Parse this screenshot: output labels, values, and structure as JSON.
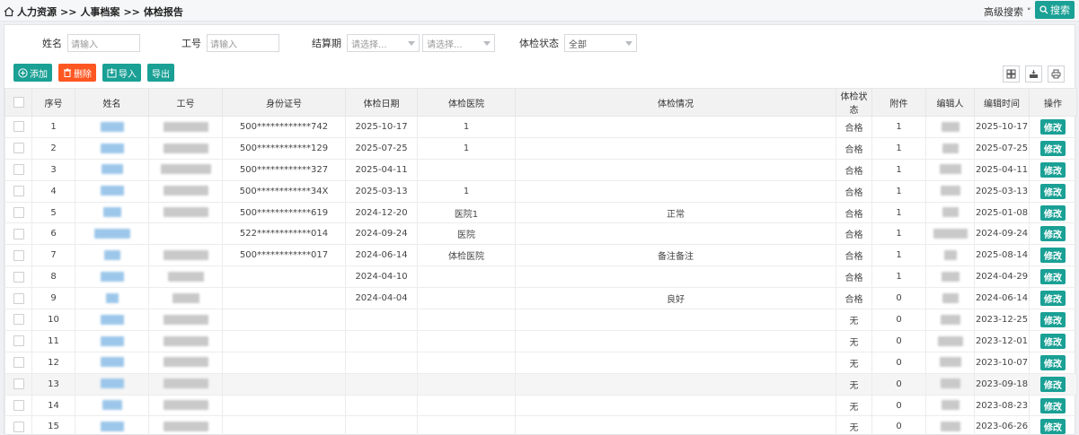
{
  "breadcrumb": {
    "level1": "人力资源",
    "level2": "人事档案",
    "level3": "体检报告",
    "separator": ">>"
  },
  "header": {
    "advanced_search": "高级搜索",
    "search_button": "搜索"
  },
  "filters": {
    "name_label": "姓名",
    "name_placeholder": "请输入",
    "id_label": "工号",
    "id_placeholder": "请输入",
    "period_label": "结算期",
    "period_select1": "请选择...",
    "period_select2": "请选择...",
    "status_label": "体检状态",
    "status_value": "全部"
  },
  "toolbar": {
    "add": "添加",
    "delete": "删除",
    "import": "导入",
    "export": "导出"
  },
  "table": {
    "columns": [
      "序号",
      "姓名",
      "工号",
      "身份证号",
      "体检日期",
      "体检医院",
      "体检情况",
      "体检状态",
      "附件",
      "编辑人",
      "编辑时间",
      "操作"
    ],
    "edit_label": "修改",
    "rows": [
      {
        "no": "1",
        "idcard": "500************742",
        "date": "2025-10-17",
        "hospital": "1",
        "condition": "",
        "status": "合格",
        "attach": "1",
        "edit_time": "2025-10-17"
      },
      {
        "no": "2",
        "idcard": "500************129",
        "date": "2025-07-25",
        "hospital": "1",
        "condition": "",
        "status": "合格",
        "attach": "1",
        "edit_time": "2025-07-25"
      },
      {
        "no": "3",
        "idcard": "500************327",
        "date": "2025-04-11",
        "hospital": "",
        "condition": "",
        "status": "合格",
        "attach": "1",
        "edit_time": "2025-04-11"
      },
      {
        "no": "4",
        "idcard": "500************34X",
        "date": "2025-03-13",
        "hospital": "1",
        "condition": "",
        "status": "合格",
        "attach": "1",
        "edit_time": "2025-03-13"
      },
      {
        "no": "5",
        "idcard": "500************619",
        "date": "2024-12-20",
        "hospital": "医院1",
        "condition": "正常",
        "status": "合格",
        "attach": "1",
        "edit_time": "2025-01-08"
      },
      {
        "no": "6",
        "idcard": "522************014",
        "date": "2024-09-24",
        "hospital": "医院",
        "condition": "",
        "status": "合格",
        "attach": "1",
        "edit_time": "2024-09-24"
      },
      {
        "no": "7",
        "idcard": "500************017",
        "date": "2024-06-14",
        "hospital": "体检医院",
        "condition": "备注备注",
        "status": "合格",
        "attach": "1",
        "edit_time": "2025-08-14"
      },
      {
        "no": "8",
        "idcard": "",
        "date": "2024-04-10",
        "hospital": "",
        "condition": "",
        "status": "合格",
        "attach": "1",
        "edit_time": "2024-04-29"
      },
      {
        "no": "9",
        "idcard": "",
        "date": "2024-04-04",
        "hospital": "",
        "condition": "良好",
        "status": "合格",
        "attach": "0",
        "edit_time": "2024-06-14"
      },
      {
        "no": "10",
        "idcard": "",
        "date": "",
        "hospital": "",
        "condition": "",
        "status": "无",
        "attach": "0",
        "edit_time": "2023-12-25"
      },
      {
        "no": "11",
        "idcard": "",
        "date": "",
        "hospital": "",
        "condition": "",
        "status": "无",
        "attach": "0",
        "edit_time": "2023-12-01"
      },
      {
        "no": "12",
        "idcard": "",
        "date": "",
        "hospital": "",
        "condition": "",
        "status": "无",
        "attach": "0",
        "edit_time": "2023-10-07"
      },
      {
        "no": "13",
        "idcard": "",
        "date": "",
        "hospital": "",
        "condition": "",
        "status": "无",
        "attach": "0",
        "edit_time": "2023-09-18"
      },
      {
        "no": "14",
        "idcard": "",
        "date": "",
        "hospital": "",
        "condition": "",
        "status": "无",
        "attach": "0",
        "edit_time": "2023-08-23"
      },
      {
        "no": "15",
        "idcard": "",
        "date": "",
        "hospital": "",
        "condition": "",
        "status": "无",
        "attach": "0",
        "edit_time": "2023-06-26"
      }
    ]
  },
  "colors": {
    "accent": "#1aa095",
    "danger": "#ff5722"
  }
}
